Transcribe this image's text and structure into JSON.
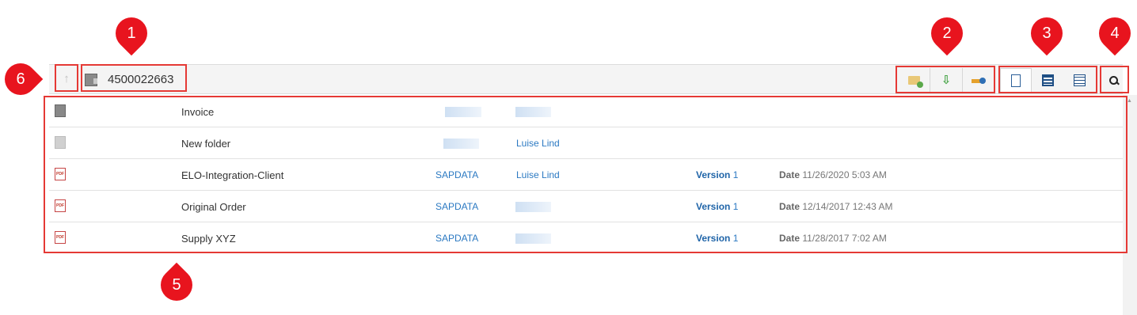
{
  "breadcrumb": {
    "up_label": "↑",
    "current": "4500022663"
  },
  "toolbar": {
    "actions": [
      "new-folder",
      "import",
      "transfer"
    ],
    "views": [
      "single-view",
      "detail-view",
      "list-view"
    ],
    "search_icon": "search-icon"
  },
  "rows": [
    {
      "icon": "folder-dark",
      "name": "Invoice",
      "c1": "",
      "c2": "",
      "version_label": "",
      "version": "",
      "date_label": "",
      "date": ""
    },
    {
      "icon": "folder-light",
      "name": "New folder",
      "c1": "",
      "c2": "Luise Lind",
      "version_label": "",
      "version": "",
      "date_label": "",
      "date": ""
    },
    {
      "icon": "pdf",
      "name": "ELO-Integration-Client",
      "c1": "SAPDATA",
      "c2": "Luise Lind",
      "version_label": "Version",
      "version": "1",
      "date_label": "Date",
      "date": "11/26/2020 5:03 AM"
    },
    {
      "icon": "pdf",
      "name": "Original Order",
      "c1": "SAPDATA",
      "c2": "",
      "version_label": "Version",
      "version": "1",
      "date_label": "Date",
      "date": "12/14/2017 12:43 AM"
    },
    {
      "icon": "pdf",
      "name": "Supply XYZ",
      "c1": "SAPDATA",
      "c2": "",
      "version_label": "Version",
      "version": "1",
      "date_label": "Date",
      "date": "11/28/2017 7:02 AM"
    }
  ],
  "pdf_glyph": "PDF",
  "callouts": {
    "n1": "1",
    "n2": "2",
    "n3": "3",
    "n4": "4",
    "n5": "5",
    "n6": "6"
  },
  "colors": {
    "callout": "#e8141e",
    "link": "#2b79c2"
  }
}
